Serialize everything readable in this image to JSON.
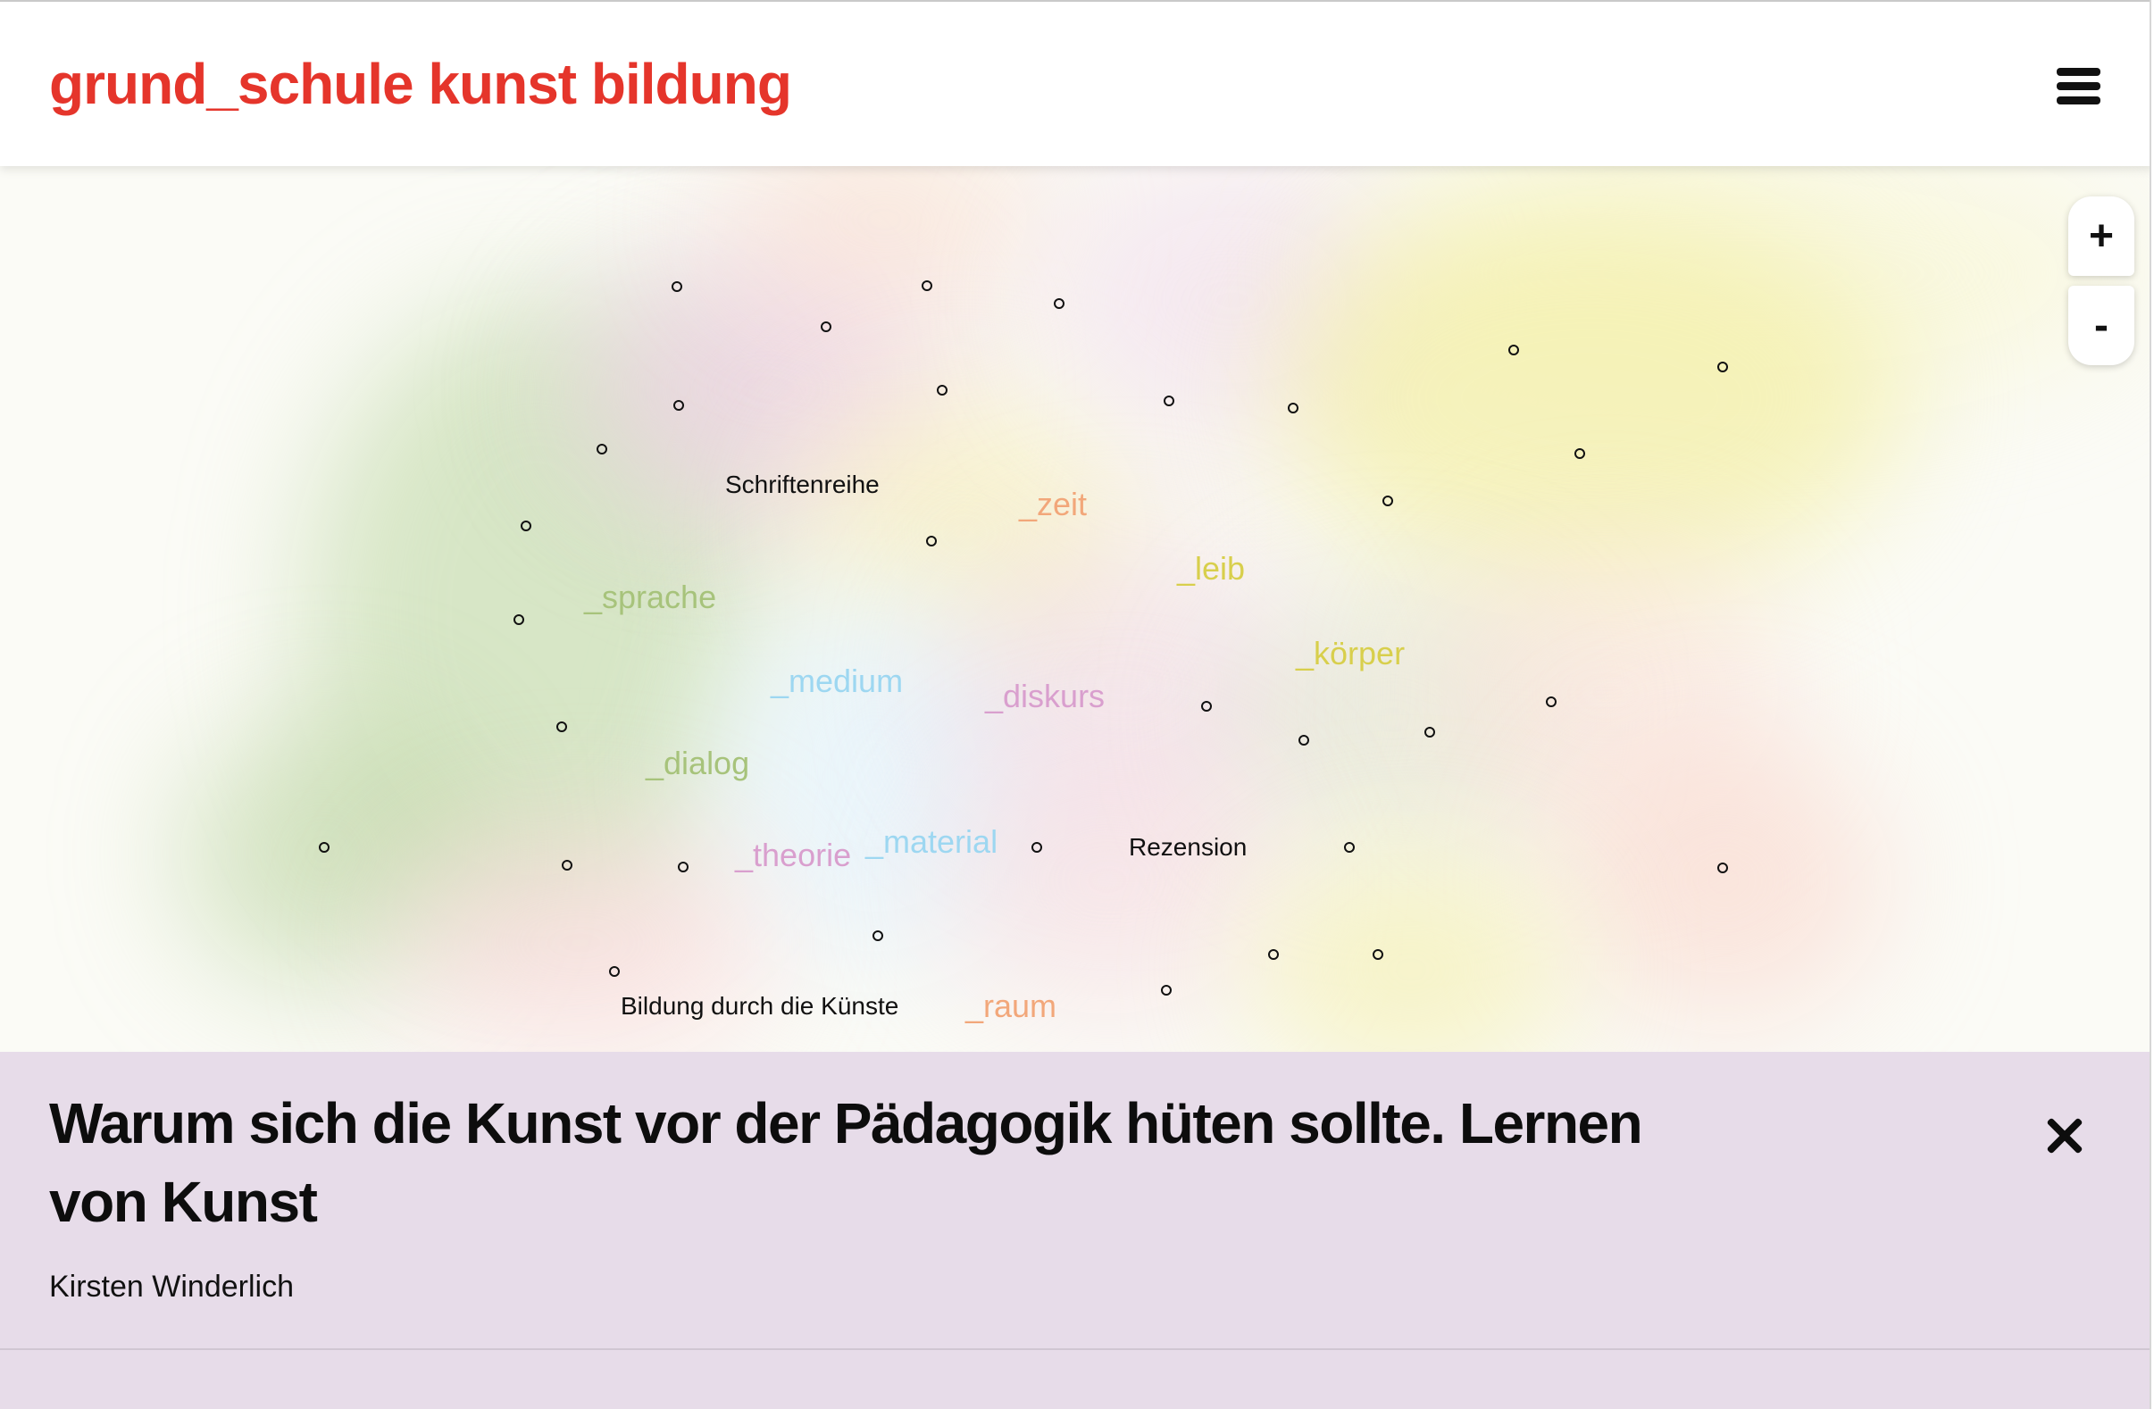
{
  "header": {
    "site_title": "grund_schule kunst bildung",
    "menu_icon": "hamburger-menu-icon"
  },
  "colors": {
    "brand_red": "#e5352b",
    "panel_background": "#e7dce9",
    "tag_orange": "#f2a77a",
    "tag_yellow": "#d8cf4c",
    "tag_green": "#a7c37b",
    "tag_blue": "#9dd7f1",
    "tag_pink": "#d99fce",
    "label_black": "#111111"
  },
  "map": {
    "zoom_in": {
      "label": "+",
      "icon": "zoom-in-icon"
    },
    "zoom_out": {
      "label": "-",
      "icon": "zoom-out-icon"
    },
    "labels": [
      {
        "text": "Schriftenreihe",
        "color": "#111111"
      },
      {
        "text": "_zeit",
        "color": "#f2a77a"
      },
      {
        "text": "_leib",
        "color": "#d8cf4c"
      },
      {
        "text": "_sprache",
        "color": "#a7c37b"
      },
      {
        "text": "_körper",
        "color": "#d8cf4c"
      },
      {
        "text": "_medium",
        "color": "#9dd7f1"
      },
      {
        "text": "_diskurs",
        "color": "#d99fce"
      },
      {
        "text": "_dialog",
        "color": "#a7c37b"
      },
      {
        "text": "_theorie",
        "color": "#d99fce"
      },
      {
        "text": "_material",
        "color": "#9dd7f1"
      },
      {
        "text": "Rezension",
        "color": "#111111"
      },
      {
        "text": "Bildung durch die Künste",
        "color": "#111111"
      },
      {
        "text": "_raum",
        "color": "#f2a77a"
      }
    ]
  },
  "article_panel": {
    "title": "Warum sich die Kunst vor der Pädagogik hüten sollte. Lernen von Kunst",
    "author": "Kirsten Winderlich",
    "close_icon": "close-icon"
  }
}
